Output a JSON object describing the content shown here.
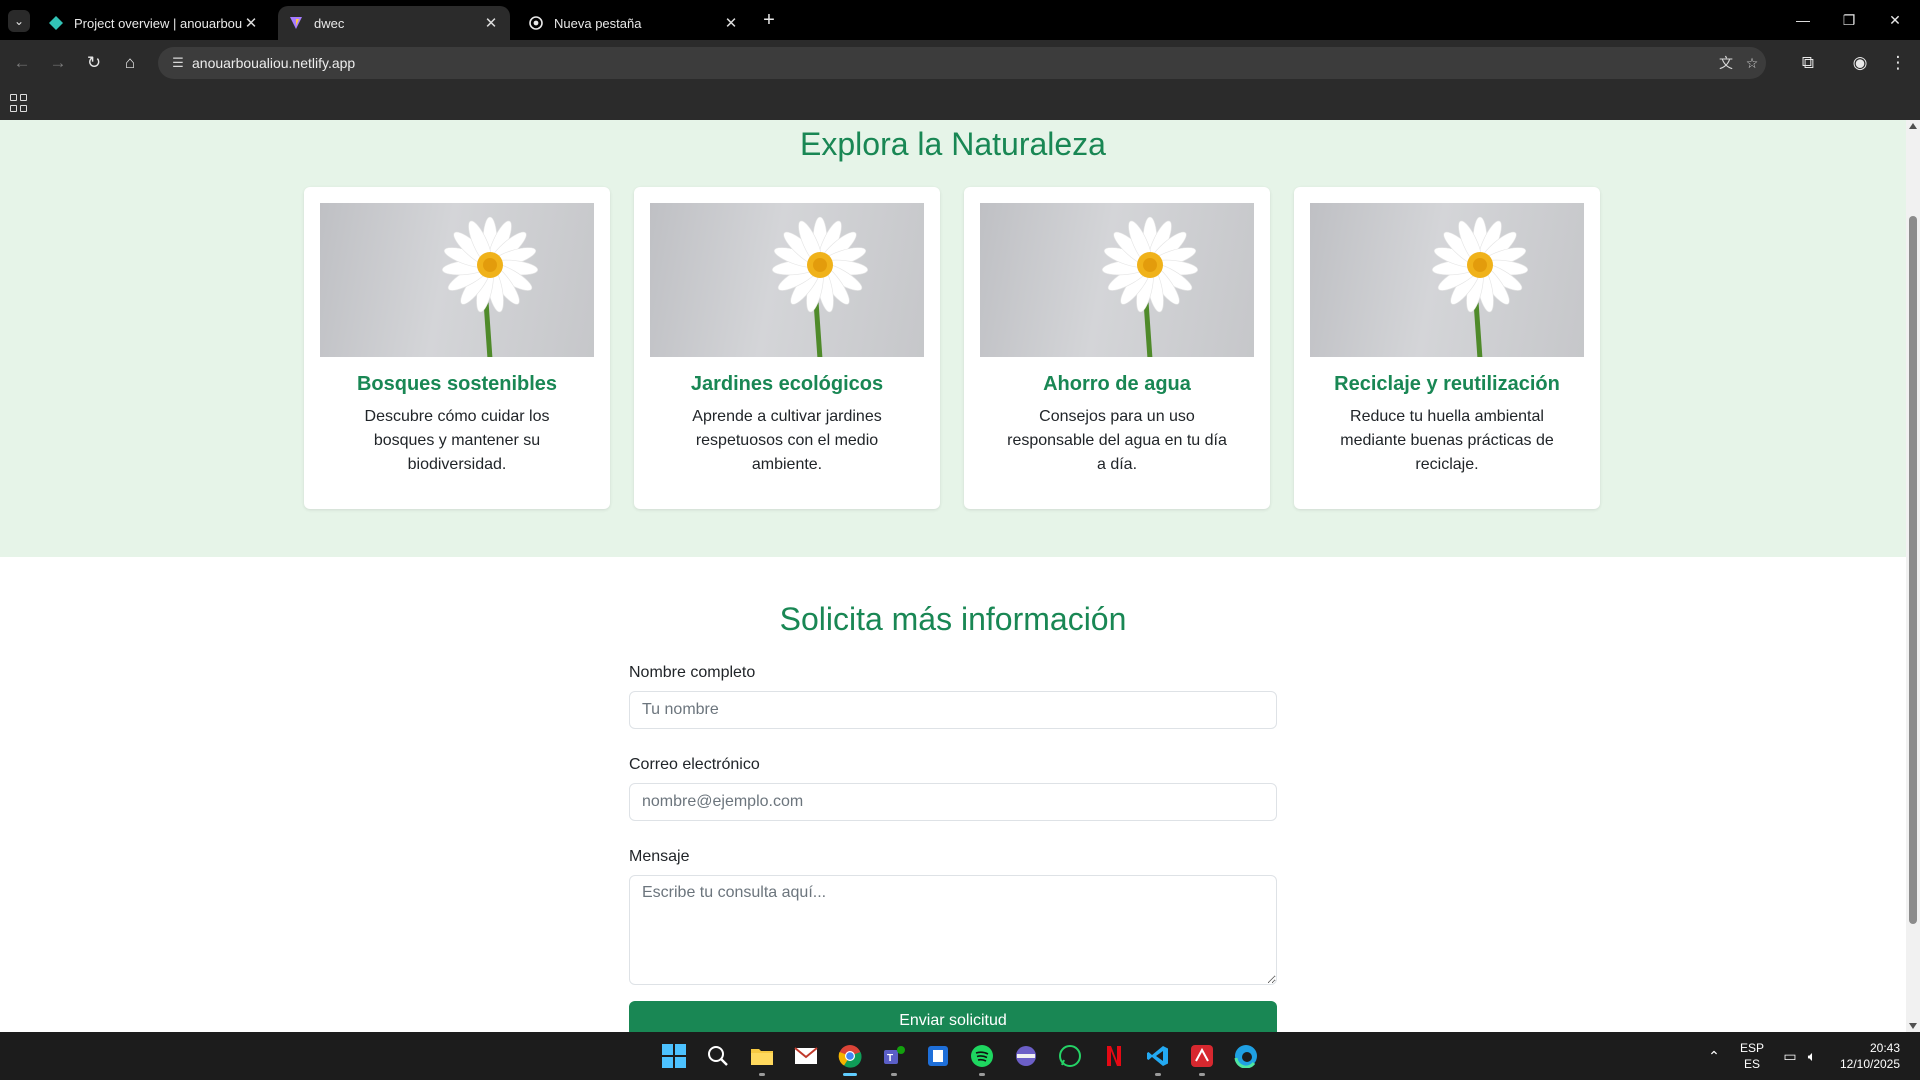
{
  "browser": {
    "tabs": [
      {
        "title": "Project overview | anouarboualiou",
        "icon": "netlify-icon",
        "active": false
      },
      {
        "title": "dwec",
        "icon": "vite-icon",
        "active": true
      },
      {
        "title": "Nueva pestaña",
        "icon": "chrome-icon",
        "active": false
      }
    ],
    "url": "anouarboualiou.netlify.app"
  },
  "page": {
    "nature_title": "Explora la Naturaleza",
    "cards": [
      {
        "title": "Bosques sostenibles",
        "text": "Descubre cómo cuidar los bosques y mantener su biodiversidad."
      },
      {
        "title": "Jardines ecológicos",
        "text": "Aprende a cultivar jardines respetuosos con el medio ambiente."
      },
      {
        "title": "Ahorro de agua",
        "text": "Consejos para un uso responsable del agua en tu día a día."
      },
      {
        "title": "Reciclaje y reutilización",
        "text": "Reduce tu huella ambiental mediante buenas prácticas de reciclaje."
      }
    ],
    "form_title": "Solicita más información",
    "form": {
      "name_label": "Nombre completo",
      "name_placeholder": "Tu nombre",
      "email_label": "Correo electrónico",
      "email_placeholder": "nombre@ejemplo.com",
      "message_label": "Mensaje",
      "message_placeholder": "Escribe tu consulta aquí...",
      "submit_label": "Enviar solicitud"
    }
  },
  "taskbar": {
    "language": "ESP",
    "layout": "ES",
    "time": "20:43",
    "date": "12/10/2025"
  },
  "colors": {
    "accent_green": "#198754",
    "nature_bg": "#e6f4e8"
  }
}
